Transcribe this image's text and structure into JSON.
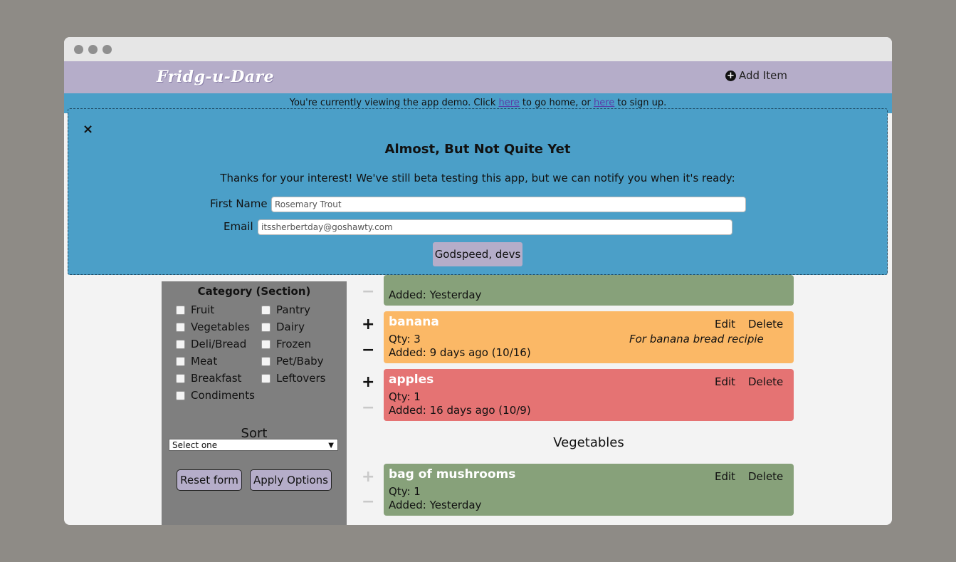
{
  "app": {
    "logo": "Fridg-u-Dare",
    "add_item": "Add Item"
  },
  "banner": {
    "before": "You're currently viewing the app demo. Click ",
    "link1": "here",
    "middle": " to go home, or ",
    "link2": "here",
    "after": " to sign up."
  },
  "sidebar": {
    "category_title": "Category (Section)",
    "categories_left": [
      "Fruit",
      "Vegetables",
      "Deli/Bread",
      "Meat",
      "Breakfast",
      "Condiments"
    ],
    "categories_right": [
      "Pantry",
      "Dairy",
      "Frozen",
      "Pet/Baby",
      "Leftovers"
    ],
    "sort_title": "Sort",
    "sort_value": "Select one",
    "reset_label": "Reset form",
    "apply_label": "Apply Options"
  },
  "items": {
    "top": {
      "added": "Added: Yesterday"
    },
    "banana": {
      "name": "banana",
      "qty": "Qty: 3",
      "added": "Added: 9 days ago (10/16)",
      "note": "For banana bread recipie"
    },
    "apples": {
      "name": "apples",
      "qty": "Qty: 1",
      "added": "Added: 16 days ago (10/9)"
    },
    "mushrooms": {
      "name": "bag of mushrooms",
      "qty": "Qty: 1",
      "added": "Added: Yesterday"
    },
    "edit_label": "Edit",
    "delete_label": "Delete",
    "plus": "+",
    "minus": "−"
  },
  "sections": {
    "vegetables": "Vegetables"
  },
  "modal": {
    "close": "×",
    "title": "Almost, But Not Quite Yet",
    "text": "Thanks for your interest! We've still beta testing this app, but we can notify you when it's ready:",
    "first_name_label": "First Name",
    "first_name_value": "Rosemary Trout",
    "email_label": "Email",
    "email_value": "itssherbertday@goshawty.com",
    "submit": "Godspeed, devs"
  },
  "colors": {
    "green": "#87a17a",
    "orange": "#fbb866",
    "red": "#e57373",
    "purple": "#b5adc9",
    "blue": "#4b9fc8"
  }
}
